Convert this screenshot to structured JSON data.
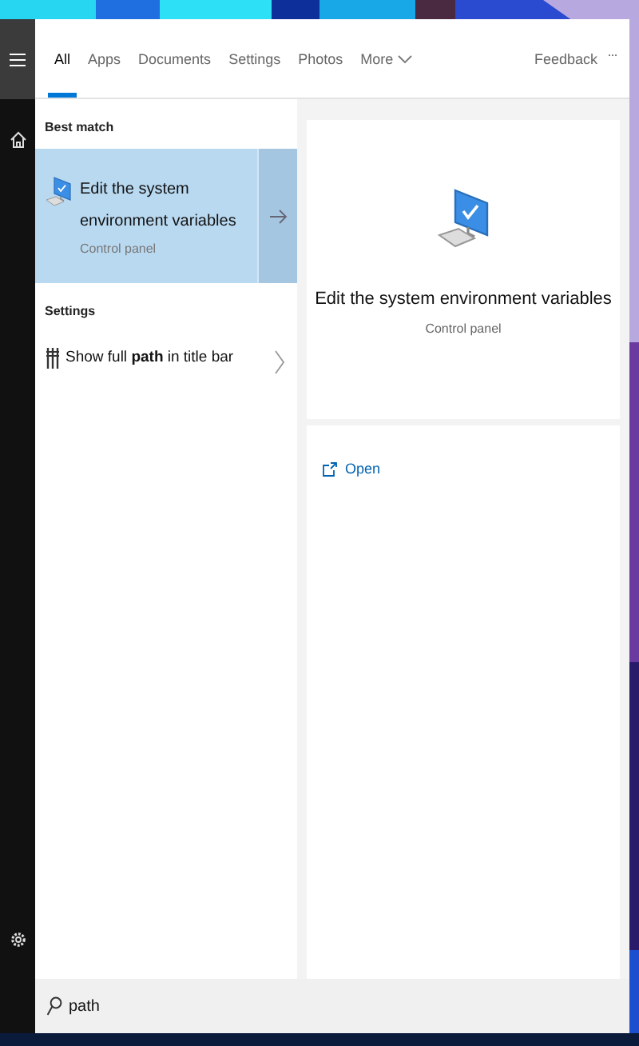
{
  "tabs": [
    {
      "label": "All",
      "selected": true,
      "kind": "tab"
    },
    {
      "label": "Apps",
      "selected": false,
      "kind": "tab"
    },
    {
      "label": "Documents",
      "selected": false,
      "kind": "tab"
    },
    {
      "label": "Settings",
      "selected": false,
      "kind": "tab"
    },
    {
      "label": "Photos",
      "selected": false,
      "kind": "tab"
    },
    {
      "label": "More",
      "selected": false,
      "kind": "dropdown"
    }
  ],
  "feedback": "Feedback",
  "more_options": "···",
  "sections": [
    {
      "heading": "Best match",
      "items": [
        {
          "title": "Edit the system environment variables",
          "subtitle": "Control panel",
          "selected": true,
          "kind": "app"
        }
      ]
    },
    {
      "heading": "Settings",
      "items": [
        {
          "title": "Show full **path** in title bar",
          "selected": false,
          "kind": "setting"
        }
      ]
    }
  ],
  "preview": {
    "title": "Edit the system environment variables",
    "subtitle": "Control panel",
    "actions": [
      {
        "label": "Open"
      }
    ]
  },
  "search": {
    "value": "path"
  }
}
